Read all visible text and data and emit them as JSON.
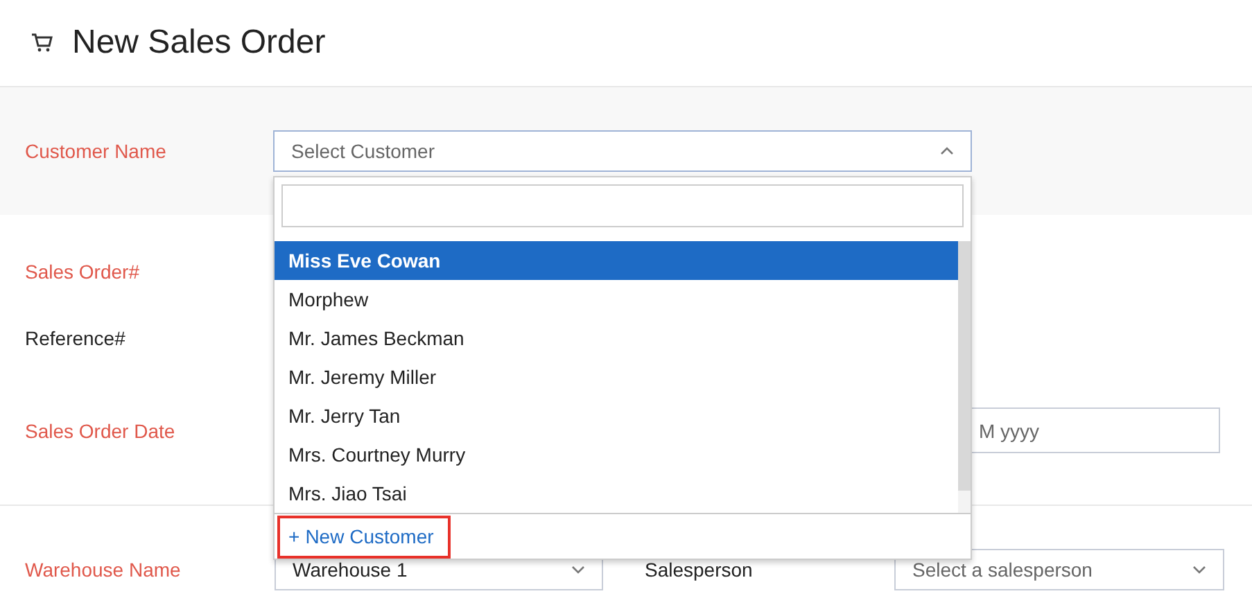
{
  "page": {
    "title": "New Sales Order"
  },
  "customer": {
    "label": "Customer Name",
    "placeholder": "Select Customer",
    "required": true,
    "expanded": true,
    "dropdown": {
      "options": [
        {
          "label": "Miss Eve Cowan",
          "selected": true
        },
        {
          "label": "Morphew",
          "selected": false
        },
        {
          "label": "Mr. James Beckman",
          "selected": false
        },
        {
          "label": "Mr. Jeremy Miller",
          "selected": false
        },
        {
          "label": "Mr. Jerry Tan",
          "selected": false
        },
        {
          "label": "Mrs. Courtney Murry",
          "selected": false
        },
        {
          "label": "Mrs. Jiao Tsai",
          "selected": false
        }
      ],
      "action": {
        "icon": "+",
        "label": "New Customer",
        "highlighted": true
      }
    }
  },
  "fields": [
    {
      "label": "Sales Order#",
      "required": true
    },
    {
      "label": "Reference#",
      "required": false
    },
    {
      "label": "Sales Order Date",
      "required": true,
      "placeholder": "M yyyy"
    }
  ],
  "warehouse": {
    "label": "Warehouse Name",
    "required": true,
    "value": "Warehouse 1"
  },
  "salesperson": {
    "label": "Salesperson",
    "required": false,
    "placeholder": "Select a salesperson"
  }
}
